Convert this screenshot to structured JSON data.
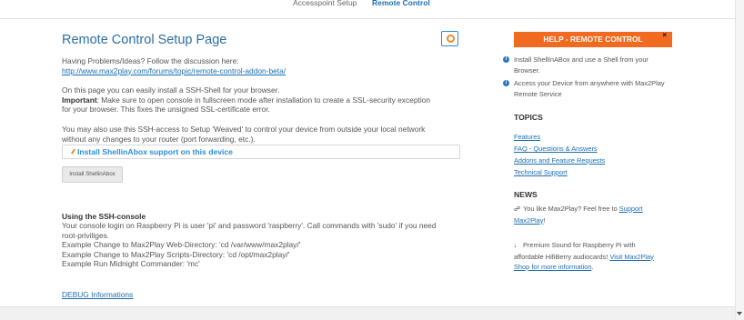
{
  "topnav": {
    "items": [
      "Accesspoint Setup",
      "Remote Control"
    ]
  },
  "main": {
    "title": "Remote Control Setup Page",
    "problems_text": "Having Problems/Ideas? Follow the discussion here:",
    "problems_link": "http://www.max2play.com/forums/topic/remote-control-addon-beta/",
    "intro_line": "On this page you can easily install a SSH-Shell for your browser.",
    "important_label": "Important",
    "important_text": ": Make sure to open console in fullscreen mode after installation to create a SSL-security exception",
    "important_line2": "for your browser. This fixes the unsigned SSL-certificate error.",
    "weaved_line1": "You may also use this SSH-access to Setup 'Weaved' to control your device from outside your local network",
    "weaved_line2": "without any changes to your router (port forwarding, etc.).",
    "install_header": "Install ShellinAbox support on this device",
    "install_button": "Install ShellinAbox",
    "usage_title": "Using the SSH-console",
    "usage_lines": [
      "Your console login on Raspberry Pi is user 'pi' and password 'raspberry'. Call commands with 'sudo' if you need",
      "root-priviliges.",
      "Example Change to Max2Play Web-Directory: 'cd /var/www/max2play/'",
      "Example Change to Max2Play Scripts-Directory: 'cd /opt/max2play/'",
      "Example Run Midnight Commander: 'mc'"
    ],
    "debug_link": "DEBUG Informations"
  },
  "sidebar": {
    "help_title": "HELP - REMOTE CONTROL",
    "close": "×",
    "info": [
      "Install ShellInABox and use a Shell from your Browser.",
      "Access your Device from anywhere with Max2Play Remote Service"
    ],
    "topics_title": "TOPICS",
    "topics": [
      "Features",
      "FAQ - Questions & Answers",
      "Addons and Feature Requests",
      "Technical Support"
    ],
    "news_title": "NEWS",
    "news1_text": "You like Max2Play? Feel free to ",
    "news1_link_a": "Support",
    "news1_link_b": "Max2Play",
    "news1_end": "!",
    "news2_line1": "Premium Sound for Raspberry Pi with",
    "news2_line2": "affordable HifiBerry audiocards! ",
    "news2_link_a": "Visit Max2Play",
    "news2_link_b": "Shop for more information",
    "news2_end": "."
  }
}
